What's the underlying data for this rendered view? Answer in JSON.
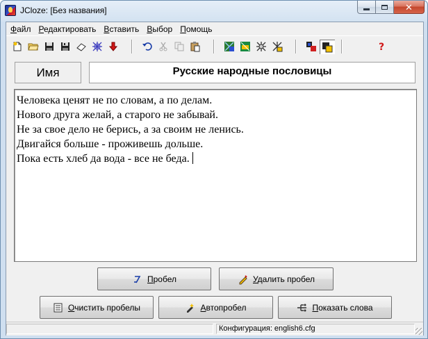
{
  "window": {
    "title": "JCloze: [Без названия]"
  },
  "menu": [
    {
      "label": "Файл",
      "mnemonic": "Ф",
      "rest": "айл"
    },
    {
      "label": "Редактировать",
      "mnemonic": "Р",
      "rest": "едактировать"
    },
    {
      "label": "Вставить",
      "mnemonic": "В",
      "rest": "ставить"
    },
    {
      "label": "Выбор",
      "mnemonic": "В",
      "rest": "ыбор"
    },
    {
      "label": "Помощь",
      "mnemonic": "П",
      "rest": "омощь"
    }
  ],
  "toolbar": {
    "icons": [
      "new-file-icon",
      "open-folder-icon",
      "save-icon",
      "save-as-icon",
      "eraser-icon",
      "web-net-icon",
      "arrow-down-icon",
      "undo-icon",
      "cut-icon",
      "copy-icon",
      "paste-icon",
      "web-export-1-icon",
      "web-export-2-icon",
      "web-export-3-icon",
      "web-export-4-icon",
      "config-icon",
      "options-icon",
      "help-icon"
    ]
  },
  "header": {
    "name_label": "Имя",
    "title_value": "Русские народные пословицы"
  },
  "text": {
    "lines": [
      "Человека ценят не по словам, а по делам.",
      "Нового друга желай, а старого не забывай.",
      "Не за свое дело не берись, а за своим не ленись.",
      "Двигайся больше - проживешь дольше.",
      "Пока есть хлеб да вода - все не беда."
    ]
  },
  "buttons": {
    "gap": {
      "label": "Пробел",
      "mnemonic": "П",
      "rest": "робел"
    },
    "delete_gap": {
      "label": "Удалить пробел",
      "mnemonic": "У",
      "rest": "далить пробел"
    },
    "clear_gaps": {
      "label": "Очистить пробелы",
      "mnemonic": "О",
      "rest": "чистить пробелы"
    },
    "auto_gap": {
      "label": "Автопробел",
      "mnemonic": "А",
      "rest": "втопробел"
    },
    "show_words": {
      "label": "Показать слова",
      "mnemonic": "П",
      "rest": "оказать слова"
    }
  },
  "status": {
    "config": "Конфигурация: english6.cfg"
  },
  "colors": {
    "titlebar_top": "#e5eef8",
    "close_button": "#c4472d",
    "face": "#f0f0f0"
  }
}
